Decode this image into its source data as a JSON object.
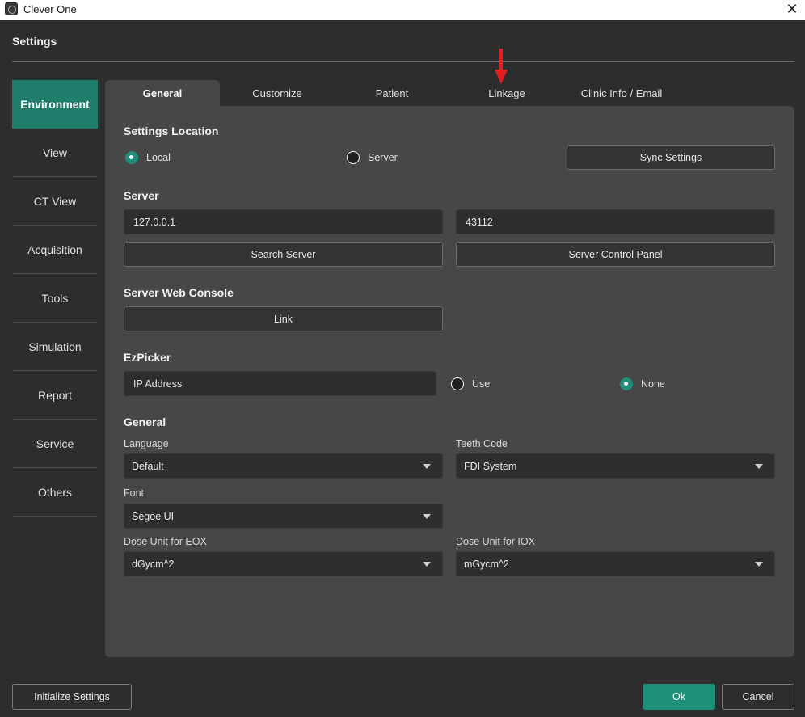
{
  "window": {
    "title": "Clever One"
  },
  "dialog": {
    "title": "Settings"
  },
  "sidebar": {
    "items": [
      {
        "label": "Environment"
      },
      {
        "label": "View"
      },
      {
        "label": "CT View"
      },
      {
        "label": "Acquisition"
      },
      {
        "label": "Tools"
      },
      {
        "label": "Simulation"
      },
      {
        "label": "Report"
      },
      {
        "label": "Service"
      },
      {
        "label": "Others"
      }
    ]
  },
  "tabs": [
    {
      "label": "General"
    },
    {
      "label": "Customize"
    },
    {
      "label": "Patient"
    },
    {
      "label": "Linkage"
    },
    {
      "label": "Clinic Info / Email"
    }
  ],
  "settings_location": {
    "heading": "Settings Location",
    "local_label": "Local",
    "server_label": "Server",
    "sync_button": "Sync Settings"
  },
  "server": {
    "heading": "Server",
    "address_value": "127.0.0.1",
    "port_value": "43112",
    "search_button": "Search Server",
    "control_panel_button": "Server Control Panel"
  },
  "web_console": {
    "heading": "Server Web Console",
    "link_button": "Link"
  },
  "ezpicker": {
    "heading": "EzPicker",
    "ip_placeholder": "IP Address",
    "use_label": "Use",
    "none_label": "None"
  },
  "general": {
    "heading": "General",
    "language_label": "Language",
    "language_value": "Default",
    "teeth_code_label": "Teeth Code",
    "teeth_code_value": "FDI System",
    "font_label": "Font",
    "font_value": "Segoe UI",
    "dose_eox_label": "Dose Unit for EOX",
    "dose_eox_value": "dGycm^2",
    "dose_iox_label": "Dose Unit for IOX",
    "dose_iox_value": "mGycm^2"
  },
  "footer": {
    "initialize_button": "Initialize Settings",
    "ok_button": "Ok",
    "cancel_button": "Cancel"
  },
  "colors": {
    "accent": "#1f8f7a",
    "sidebar_active": "#1f7d6c",
    "panel_bg": "#474747",
    "window_bg": "#2d2d2d",
    "annotation_arrow": "#e02020"
  },
  "icons": {
    "app": "app-logo-icon",
    "close": "close-icon",
    "dropdown": "chevron-down-icon",
    "annotation": "red-arrow-icon"
  }
}
